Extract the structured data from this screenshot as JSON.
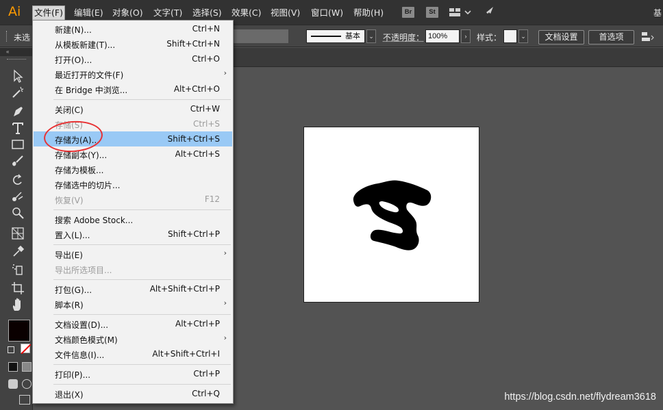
{
  "menubar": {
    "logo": "Ai",
    "items": [
      "文件(F)",
      "编辑(E)",
      "对象(O)",
      "文字(T)",
      "选择(S)",
      "效果(C)",
      "视图(V)",
      "窗口(W)",
      "帮助(H)"
    ],
    "bridge_badge": "Br",
    "stock_badge": "St",
    "right_edge_label": "基"
  },
  "controlbar": {
    "left_label": "未选",
    "stroke_style": "基本",
    "opacity_label": "不透明度：",
    "opacity_value": "100%",
    "style_label": "样式：",
    "doc_setup_button": "文档设置",
    "prefs_button": "首选项"
  },
  "file_menu": {
    "items": [
      {
        "label": "新建(N)...",
        "shortcut": "Ctrl+N"
      },
      {
        "label": "从模板新建(T)...",
        "shortcut": "Shift+Ctrl+N"
      },
      {
        "label": "打开(O)...",
        "shortcut": "Ctrl+O"
      },
      {
        "label": "最近打开的文件(F)",
        "shortcut": ""
      },
      {
        "label": "在 Bridge 中浏览...",
        "shortcut": "Alt+Ctrl+O"
      },
      {
        "label": "关闭(C)",
        "shortcut": "Ctrl+W"
      },
      {
        "label": "存储(S)",
        "shortcut": "Ctrl+S"
      },
      {
        "label": "存储为(A)...",
        "shortcut": "Shift+Ctrl+S"
      },
      {
        "label": "存储副本(Y)...",
        "shortcut": "Alt+Ctrl+S"
      },
      {
        "label": "存储为模板...",
        "shortcut": ""
      },
      {
        "label": "存储选中的切片...",
        "shortcut": ""
      },
      {
        "label": "恢复(V)",
        "shortcut": "F12"
      },
      {
        "label": "搜索 Adobe Stock...",
        "shortcut": ""
      },
      {
        "label": "置入(L)...",
        "shortcut": "Shift+Ctrl+P"
      },
      {
        "label": "导出(E)",
        "shortcut": ""
      },
      {
        "label": "导出所选项目...",
        "shortcut": ""
      },
      {
        "label": "打包(G)...",
        "shortcut": "Alt+Shift+Ctrl+P"
      },
      {
        "label": "脚本(R)",
        "shortcut": ""
      },
      {
        "label": "文档设置(D)...",
        "shortcut": "Alt+Ctrl+P"
      },
      {
        "label": "文档颜色模式(M)",
        "shortcut": ""
      },
      {
        "label": "文件信息(I)...",
        "shortcut": "Alt+Shift+Ctrl+I"
      },
      {
        "label": "打印(P)...",
        "shortcut": "Ctrl+P"
      },
      {
        "label": "退出(X)",
        "shortcut": "Ctrl+Q"
      }
    ]
  },
  "colors": {
    "highlight": "#99c9f5",
    "annotation": "#e83234",
    "logo": "#FF9A00"
  },
  "watermark": "https://blog.csdn.net/flydream3618"
}
